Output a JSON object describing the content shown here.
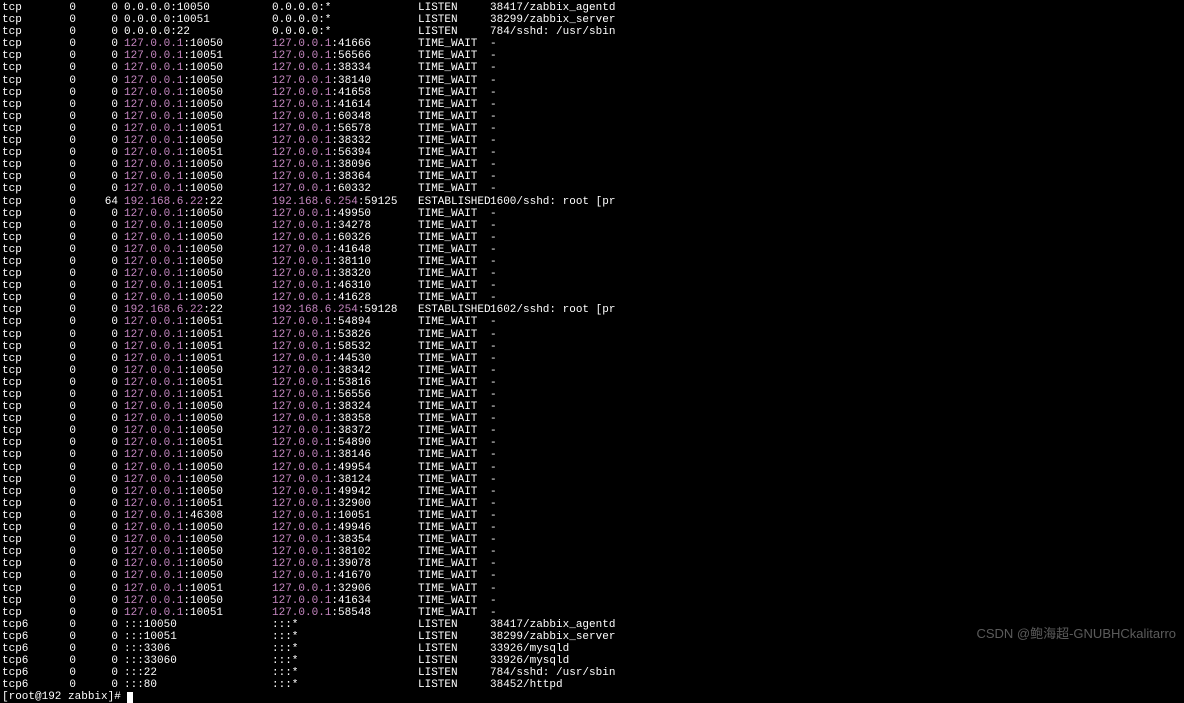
{
  "rows": [
    {
      "proto": "tcp",
      "recvq": "0",
      "sendq": "0",
      "laddr_ip": "0.0.0.0",
      "laddr_port": ":10050",
      "raddr_ip": "0.0.0.0",
      "raddr_port": ":*",
      "state": "LISTEN",
      "proc": "38417/zabbix_agentd"
    },
    {
      "proto": "tcp",
      "recvq": "0",
      "sendq": "0",
      "laddr_ip": "0.0.0.0",
      "laddr_port": ":10051",
      "raddr_ip": "0.0.0.0",
      "raddr_port": ":*",
      "state": "LISTEN",
      "proc": "38299/zabbix_server"
    },
    {
      "proto": "tcp",
      "recvq": "0",
      "sendq": "0",
      "laddr_ip": "0.0.0.0",
      "laddr_port": ":22",
      "raddr_ip": "0.0.0.0",
      "raddr_port": ":*",
      "state": "LISTEN",
      "proc": "784/sshd: /usr/sbin"
    },
    {
      "proto": "tcp",
      "recvq": "0",
      "sendq": "0",
      "laddr_ip": "127.0.0.1",
      "laddr_port": ":10050",
      "raddr_ip": "127.0.0.1",
      "raddr_port": ":41666",
      "state": "TIME_WAIT",
      "proc": "-",
      "hl": true
    },
    {
      "proto": "tcp",
      "recvq": "0",
      "sendq": "0",
      "laddr_ip": "127.0.0.1",
      "laddr_port": ":10051",
      "raddr_ip": "127.0.0.1",
      "raddr_port": ":56566",
      "state": "TIME_WAIT",
      "proc": "-",
      "hl": true
    },
    {
      "proto": "tcp",
      "recvq": "0",
      "sendq": "0",
      "laddr_ip": "127.0.0.1",
      "laddr_port": ":10050",
      "raddr_ip": "127.0.0.1",
      "raddr_port": ":38334",
      "state": "TIME_WAIT",
      "proc": "-",
      "hl": true
    },
    {
      "proto": "tcp",
      "recvq": "0",
      "sendq": "0",
      "laddr_ip": "127.0.0.1",
      "laddr_port": ":10050",
      "raddr_ip": "127.0.0.1",
      "raddr_port": ":38140",
      "state": "TIME_WAIT",
      "proc": "-",
      "hl": true
    },
    {
      "proto": "tcp",
      "recvq": "0",
      "sendq": "0",
      "laddr_ip": "127.0.0.1",
      "laddr_port": ":10050",
      "raddr_ip": "127.0.0.1",
      "raddr_port": ":41658",
      "state": "TIME_WAIT",
      "proc": "-",
      "hl": true
    },
    {
      "proto": "tcp",
      "recvq": "0",
      "sendq": "0",
      "laddr_ip": "127.0.0.1",
      "laddr_port": ":10050",
      "raddr_ip": "127.0.0.1",
      "raddr_port": ":41614",
      "state": "TIME_WAIT",
      "proc": "-",
      "hl": true
    },
    {
      "proto": "tcp",
      "recvq": "0",
      "sendq": "0",
      "laddr_ip": "127.0.0.1",
      "laddr_port": ":10050",
      "raddr_ip": "127.0.0.1",
      "raddr_port": ":60348",
      "state": "TIME_WAIT",
      "proc": "-",
      "hl": true
    },
    {
      "proto": "tcp",
      "recvq": "0",
      "sendq": "0",
      "laddr_ip": "127.0.0.1",
      "laddr_port": ":10051",
      "raddr_ip": "127.0.0.1",
      "raddr_port": ":56578",
      "state": "TIME_WAIT",
      "proc": "-",
      "hl": true
    },
    {
      "proto": "tcp",
      "recvq": "0",
      "sendq": "0",
      "laddr_ip": "127.0.0.1",
      "laddr_port": ":10050",
      "raddr_ip": "127.0.0.1",
      "raddr_port": ":38332",
      "state": "TIME_WAIT",
      "proc": "-",
      "hl": true
    },
    {
      "proto": "tcp",
      "recvq": "0",
      "sendq": "0",
      "laddr_ip": "127.0.0.1",
      "laddr_port": ":10051",
      "raddr_ip": "127.0.0.1",
      "raddr_port": ":56394",
      "state": "TIME_WAIT",
      "proc": "-",
      "hl": true
    },
    {
      "proto": "tcp",
      "recvq": "0",
      "sendq": "0",
      "laddr_ip": "127.0.0.1",
      "laddr_port": ":10050",
      "raddr_ip": "127.0.0.1",
      "raddr_port": ":38096",
      "state": "TIME_WAIT",
      "proc": "-",
      "hl": true
    },
    {
      "proto": "tcp",
      "recvq": "0",
      "sendq": "0",
      "laddr_ip": "127.0.0.1",
      "laddr_port": ":10050",
      "raddr_ip": "127.0.0.1",
      "raddr_port": ":38364",
      "state": "TIME_WAIT",
      "proc": "-",
      "hl": true
    },
    {
      "proto": "tcp",
      "recvq": "0",
      "sendq": "0",
      "laddr_ip": "127.0.0.1",
      "laddr_port": ":10050",
      "raddr_ip": "127.0.0.1",
      "raddr_port": ":60332",
      "state": "TIME_WAIT",
      "proc": "-",
      "hl": true
    },
    {
      "proto": "tcp",
      "recvq": "0",
      "sendq": "64",
      "laddr_ip": "192.168.6.22",
      "laddr_port": ":22",
      "raddr_ip": "192.168.6.254",
      "raddr_port": ":59125",
      "state": "ESTABLISHED",
      "proc": "1600/sshd: root [pr",
      "hl": true
    },
    {
      "proto": "tcp",
      "recvq": "0",
      "sendq": "0",
      "laddr_ip": "127.0.0.1",
      "laddr_port": ":10050",
      "raddr_ip": "127.0.0.1",
      "raddr_port": ":49950",
      "state": "TIME_WAIT",
      "proc": "-",
      "hl": true
    },
    {
      "proto": "tcp",
      "recvq": "0",
      "sendq": "0",
      "laddr_ip": "127.0.0.1",
      "laddr_port": ":10050",
      "raddr_ip": "127.0.0.1",
      "raddr_port": ":34278",
      "state": "TIME_WAIT",
      "proc": "-",
      "hl": true
    },
    {
      "proto": "tcp",
      "recvq": "0",
      "sendq": "0",
      "laddr_ip": "127.0.0.1",
      "laddr_port": ":10050",
      "raddr_ip": "127.0.0.1",
      "raddr_port": ":60326",
      "state": "TIME_WAIT",
      "proc": "-",
      "hl": true
    },
    {
      "proto": "tcp",
      "recvq": "0",
      "sendq": "0",
      "laddr_ip": "127.0.0.1",
      "laddr_port": ":10050",
      "raddr_ip": "127.0.0.1",
      "raddr_port": ":41648",
      "state": "TIME_WAIT",
      "proc": "-",
      "hl": true
    },
    {
      "proto": "tcp",
      "recvq": "0",
      "sendq": "0",
      "laddr_ip": "127.0.0.1",
      "laddr_port": ":10050",
      "raddr_ip": "127.0.0.1",
      "raddr_port": ":38110",
      "state": "TIME_WAIT",
      "proc": "-",
      "hl": true
    },
    {
      "proto": "tcp",
      "recvq": "0",
      "sendq": "0",
      "laddr_ip": "127.0.0.1",
      "laddr_port": ":10050",
      "raddr_ip": "127.0.0.1",
      "raddr_port": ":38320",
      "state": "TIME_WAIT",
      "proc": "-",
      "hl": true
    },
    {
      "proto": "tcp",
      "recvq": "0",
      "sendq": "0",
      "laddr_ip": "127.0.0.1",
      "laddr_port": ":10051",
      "raddr_ip": "127.0.0.1",
      "raddr_port": ":46310",
      "state": "TIME_WAIT",
      "proc": "-",
      "hl": true
    },
    {
      "proto": "tcp",
      "recvq": "0",
      "sendq": "0",
      "laddr_ip": "127.0.0.1",
      "laddr_port": ":10050",
      "raddr_ip": "127.0.0.1",
      "raddr_port": ":41628",
      "state": "TIME_WAIT",
      "proc": "-",
      "hl": true
    },
    {
      "proto": "tcp",
      "recvq": "0",
      "sendq": "0",
      "laddr_ip": "192.168.6.22",
      "laddr_port": ":22",
      "raddr_ip": "192.168.6.254",
      "raddr_port": ":59128",
      "state": "ESTABLISHED",
      "proc": "1602/sshd: root [pr",
      "hl": true
    },
    {
      "proto": "tcp",
      "recvq": "0",
      "sendq": "0",
      "laddr_ip": "127.0.0.1",
      "laddr_port": ":10051",
      "raddr_ip": "127.0.0.1",
      "raddr_port": ":54894",
      "state": "TIME_WAIT",
      "proc": "-",
      "hl": true
    },
    {
      "proto": "tcp",
      "recvq": "0",
      "sendq": "0",
      "laddr_ip": "127.0.0.1",
      "laddr_port": ":10051",
      "raddr_ip": "127.0.0.1",
      "raddr_port": ":53826",
      "state": "TIME_WAIT",
      "proc": "-",
      "hl": true
    },
    {
      "proto": "tcp",
      "recvq": "0",
      "sendq": "0",
      "laddr_ip": "127.0.0.1",
      "laddr_port": ":10051",
      "raddr_ip": "127.0.0.1",
      "raddr_port": ":58532",
      "state": "TIME_WAIT",
      "proc": "-",
      "hl": true
    },
    {
      "proto": "tcp",
      "recvq": "0",
      "sendq": "0",
      "laddr_ip": "127.0.0.1",
      "laddr_port": ":10051",
      "raddr_ip": "127.0.0.1",
      "raddr_port": ":44530",
      "state": "TIME_WAIT",
      "proc": "-",
      "hl": true
    },
    {
      "proto": "tcp",
      "recvq": "0",
      "sendq": "0",
      "laddr_ip": "127.0.0.1",
      "laddr_port": ":10050",
      "raddr_ip": "127.0.0.1",
      "raddr_port": ":38342",
      "state": "TIME_WAIT",
      "proc": "-",
      "hl": true
    },
    {
      "proto": "tcp",
      "recvq": "0",
      "sendq": "0",
      "laddr_ip": "127.0.0.1",
      "laddr_port": ":10051",
      "raddr_ip": "127.0.0.1",
      "raddr_port": ":53816",
      "state": "TIME_WAIT",
      "proc": "-",
      "hl": true
    },
    {
      "proto": "tcp",
      "recvq": "0",
      "sendq": "0",
      "laddr_ip": "127.0.0.1",
      "laddr_port": ":10051",
      "raddr_ip": "127.0.0.1",
      "raddr_port": ":56556",
      "state": "TIME_WAIT",
      "proc": "-",
      "hl": true
    },
    {
      "proto": "tcp",
      "recvq": "0",
      "sendq": "0",
      "laddr_ip": "127.0.0.1",
      "laddr_port": ":10050",
      "raddr_ip": "127.0.0.1",
      "raddr_port": ":38324",
      "state": "TIME_WAIT",
      "proc": "-",
      "hl": true
    },
    {
      "proto": "tcp",
      "recvq": "0",
      "sendq": "0",
      "laddr_ip": "127.0.0.1",
      "laddr_port": ":10050",
      "raddr_ip": "127.0.0.1",
      "raddr_port": ":38358",
      "state": "TIME_WAIT",
      "proc": "-",
      "hl": true
    },
    {
      "proto": "tcp",
      "recvq": "0",
      "sendq": "0",
      "laddr_ip": "127.0.0.1",
      "laddr_port": ":10050",
      "raddr_ip": "127.0.0.1",
      "raddr_port": ":38372",
      "state": "TIME_WAIT",
      "proc": "-",
      "hl": true
    },
    {
      "proto": "tcp",
      "recvq": "0",
      "sendq": "0",
      "laddr_ip": "127.0.0.1",
      "laddr_port": ":10051",
      "raddr_ip": "127.0.0.1",
      "raddr_port": ":54890",
      "state": "TIME_WAIT",
      "proc": "-",
      "hl": true
    },
    {
      "proto": "tcp",
      "recvq": "0",
      "sendq": "0",
      "laddr_ip": "127.0.0.1",
      "laddr_port": ":10050",
      "raddr_ip": "127.0.0.1",
      "raddr_port": ":38146",
      "state": "TIME_WAIT",
      "proc": "-",
      "hl": true
    },
    {
      "proto": "tcp",
      "recvq": "0",
      "sendq": "0",
      "laddr_ip": "127.0.0.1",
      "laddr_port": ":10050",
      "raddr_ip": "127.0.0.1",
      "raddr_port": ":49954",
      "state": "TIME_WAIT",
      "proc": "-",
      "hl": true
    },
    {
      "proto": "tcp",
      "recvq": "0",
      "sendq": "0",
      "laddr_ip": "127.0.0.1",
      "laddr_port": ":10050",
      "raddr_ip": "127.0.0.1",
      "raddr_port": ":38124",
      "state": "TIME_WAIT",
      "proc": "-",
      "hl": true
    },
    {
      "proto": "tcp",
      "recvq": "0",
      "sendq": "0",
      "laddr_ip": "127.0.0.1",
      "laddr_port": ":10050",
      "raddr_ip": "127.0.0.1",
      "raddr_port": ":49942",
      "state": "TIME_WAIT",
      "proc": "-",
      "hl": true
    },
    {
      "proto": "tcp",
      "recvq": "0",
      "sendq": "0",
      "laddr_ip": "127.0.0.1",
      "laddr_port": ":10051",
      "raddr_ip": "127.0.0.1",
      "raddr_port": ":32900",
      "state": "TIME_WAIT",
      "proc": "-",
      "hl": true
    },
    {
      "proto": "tcp",
      "recvq": "0",
      "sendq": "0",
      "laddr_ip": "127.0.0.1",
      "laddr_port": ":46308",
      "raddr_ip": "127.0.0.1",
      "raddr_port": ":10051",
      "state": "TIME_WAIT",
      "proc": "-",
      "hl": true
    },
    {
      "proto": "tcp",
      "recvq": "0",
      "sendq": "0",
      "laddr_ip": "127.0.0.1",
      "laddr_port": ":10050",
      "raddr_ip": "127.0.0.1",
      "raddr_port": ":49946",
      "state": "TIME_WAIT",
      "proc": "-",
      "hl": true
    },
    {
      "proto": "tcp",
      "recvq": "0",
      "sendq": "0",
      "laddr_ip": "127.0.0.1",
      "laddr_port": ":10050",
      "raddr_ip": "127.0.0.1",
      "raddr_port": ":38354",
      "state": "TIME_WAIT",
      "proc": "-",
      "hl": true
    },
    {
      "proto": "tcp",
      "recvq": "0",
      "sendq": "0",
      "laddr_ip": "127.0.0.1",
      "laddr_port": ":10050",
      "raddr_ip": "127.0.0.1",
      "raddr_port": ":38102",
      "state": "TIME_WAIT",
      "proc": "-",
      "hl": true
    },
    {
      "proto": "tcp",
      "recvq": "0",
      "sendq": "0",
      "laddr_ip": "127.0.0.1",
      "laddr_port": ":10050",
      "raddr_ip": "127.0.0.1",
      "raddr_port": ":39078",
      "state": "TIME_WAIT",
      "proc": "-",
      "hl": true
    },
    {
      "proto": "tcp",
      "recvq": "0",
      "sendq": "0",
      "laddr_ip": "127.0.0.1",
      "laddr_port": ":10050",
      "raddr_ip": "127.0.0.1",
      "raddr_port": ":41670",
      "state": "TIME_WAIT",
      "proc": "-",
      "hl": true
    },
    {
      "proto": "tcp",
      "recvq": "0",
      "sendq": "0",
      "laddr_ip": "127.0.0.1",
      "laddr_port": ":10051",
      "raddr_ip": "127.0.0.1",
      "raddr_port": ":32906",
      "state": "TIME_WAIT",
      "proc": "-",
      "hl": true
    },
    {
      "proto": "tcp",
      "recvq": "0",
      "sendq": "0",
      "laddr_ip": "127.0.0.1",
      "laddr_port": ":10050",
      "raddr_ip": "127.0.0.1",
      "raddr_port": ":41634",
      "state": "TIME_WAIT",
      "proc": "-",
      "hl": true
    },
    {
      "proto": "tcp",
      "recvq": "0",
      "sendq": "0",
      "laddr_ip": "127.0.0.1",
      "laddr_port": ":10051",
      "raddr_ip": "127.0.0.1",
      "raddr_port": ":58548",
      "state": "TIME_WAIT",
      "proc": "-",
      "hl": true
    },
    {
      "proto": "tcp6",
      "recvq": "0",
      "sendq": "0",
      "laddr_ip": ":::",
      "laddr_port": "10050",
      "raddr_ip": ":::",
      "raddr_port": "*",
      "state": "LISTEN",
      "proc": "38417/zabbix_agentd"
    },
    {
      "proto": "tcp6",
      "recvq": "0",
      "sendq": "0",
      "laddr_ip": ":::",
      "laddr_port": "10051",
      "raddr_ip": ":::",
      "raddr_port": "*",
      "state": "LISTEN",
      "proc": "38299/zabbix_server"
    },
    {
      "proto": "tcp6",
      "recvq": "0",
      "sendq": "0",
      "laddr_ip": ":::",
      "laddr_port": "3306",
      "raddr_ip": ":::",
      "raddr_port": "*",
      "state": "LISTEN",
      "proc": "33926/mysqld"
    },
    {
      "proto": "tcp6",
      "recvq": "0",
      "sendq": "0",
      "laddr_ip": ":::",
      "laddr_port": "33060",
      "raddr_ip": ":::",
      "raddr_port": "*",
      "state": "LISTEN",
      "proc": "33926/mysqld"
    },
    {
      "proto": "tcp6",
      "recvq": "0",
      "sendq": "0",
      "laddr_ip": ":::",
      "laddr_port": "22",
      "raddr_ip": ":::",
      "raddr_port": "*",
      "state": "LISTEN",
      "proc": "784/sshd: /usr/sbin"
    },
    {
      "proto": "tcp6",
      "recvq": "0",
      "sendq": "0",
      "laddr_ip": ":::",
      "laddr_port": "80",
      "raddr_ip": ":::",
      "raddr_port": "*",
      "state": "LISTEN",
      "proc": "38452/httpd"
    }
  ],
  "prompt": "[root@192 zabbix]# ",
  "watermark": "CSDN @鲍海超-GNUBHCkalitarro"
}
